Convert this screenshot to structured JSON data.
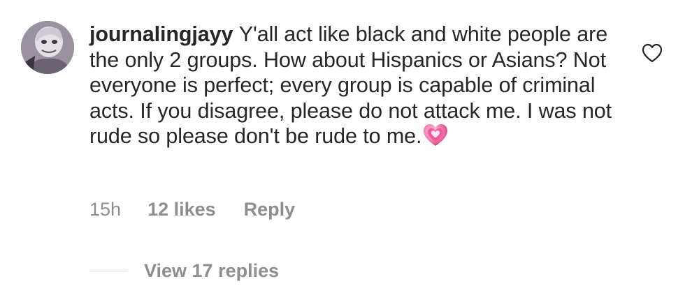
{
  "comment": {
    "username": "journalingjayy",
    "text": "Y'all act like black and white people are the only 2 groups. How about Hispanics or Asians? Not everyone is perfect; every group is capable of criminal acts. If you disagree, please do not attack me. I was not rude so please don't be rude to me.",
    "emoji": "growing-heart-emoji"
  },
  "meta": {
    "time": "15h",
    "likes": "12 likes",
    "reply_label": "Reply"
  },
  "replies": {
    "view_label": "View 17 replies"
  },
  "icons": {
    "like": "heart-outline-icon",
    "avatar": "profile-avatar"
  },
  "colors": {
    "text": "#262626",
    "secondary": "#8e8e8e",
    "emoji_pink": "#e0488a"
  }
}
